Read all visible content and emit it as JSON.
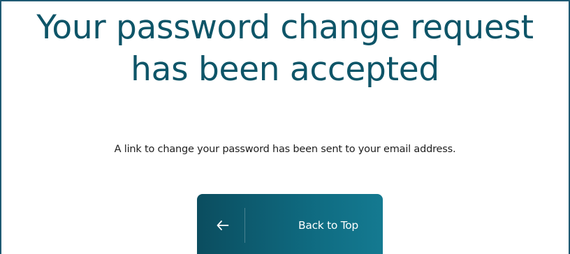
{
  "heading": {
    "line1": "Your password change request",
    "line2": "has been accepted"
  },
  "message": "A link to change your password has been sent to your email address.",
  "back_button": {
    "label": "Back to Top",
    "icon": "arrow-left-icon"
  },
  "colors": {
    "heading": "#0e5568",
    "button_start": "#0b4d5f",
    "button_end": "#147a91",
    "border": "#1f5a73"
  }
}
